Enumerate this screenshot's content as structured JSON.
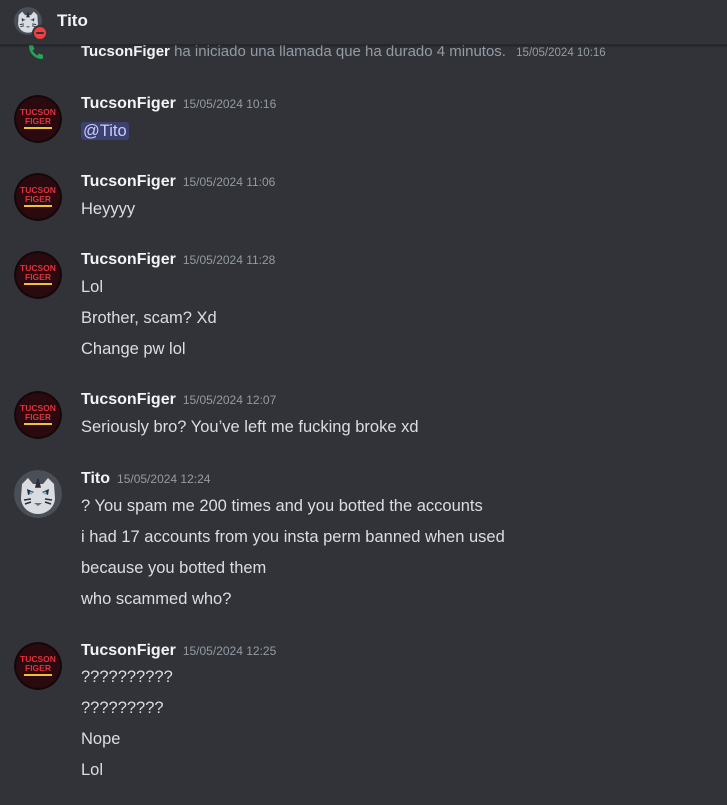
{
  "header": {
    "title": "Tito",
    "status": "do-not-disturb"
  },
  "call_message": {
    "author": "TucsonFiger",
    "text": "ha iniciado una llamada que ha durado 4 minutos.",
    "time": "15/05/2024 10:16"
  },
  "avatars": {
    "tucson_logo_line1": "TUCSON",
    "tucson_logo_line2": "FIGER"
  },
  "messages": [
    {
      "author": "TucsonFiger",
      "time": "15/05/2024 10:16",
      "mention": "@Tito",
      "lines": []
    },
    {
      "author": "TucsonFiger",
      "time": "15/05/2024 11:06",
      "lines": [
        "Heyyyy"
      ]
    },
    {
      "author": "TucsonFiger",
      "time": "15/05/2024 11:28",
      "lines": [
        "Lol",
        "Brother, scam? Xd",
        "Change pw lol"
      ]
    },
    {
      "author": "TucsonFiger",
      "time": "15/05/2024 12:07",
      "lines": [
        "Seriously bro? You’ve left me fucking broke xd"
      ]
    },
    {
      "author": "Tito",
      "time": "15/05/2024 12:24",
      "lines": [
        "? You spam me 200 times and you botted the accounts",
        "i had 17 accounts from you insta perm banned when used",
        "because you botted them",
        "who scammed who?"
      ]
    },
    {
      "author": "TucsonFiger",
      "time": "15/05/2024 12:25",
      "lines": [
        "??????????",
        "?????????",
        "Nope",
        "Lol"
      ]
    }
  ],
  "colors": {
    "background": "#313338",
    "username": "#f2f3f5",
    "text": "#dbdee1",
    "timestamp": "#949ba4",
    "mention_bg": "#3c4270",
    "status_dnd": "#f23f43",
    "call_green": "#23a55a"
  }
}
